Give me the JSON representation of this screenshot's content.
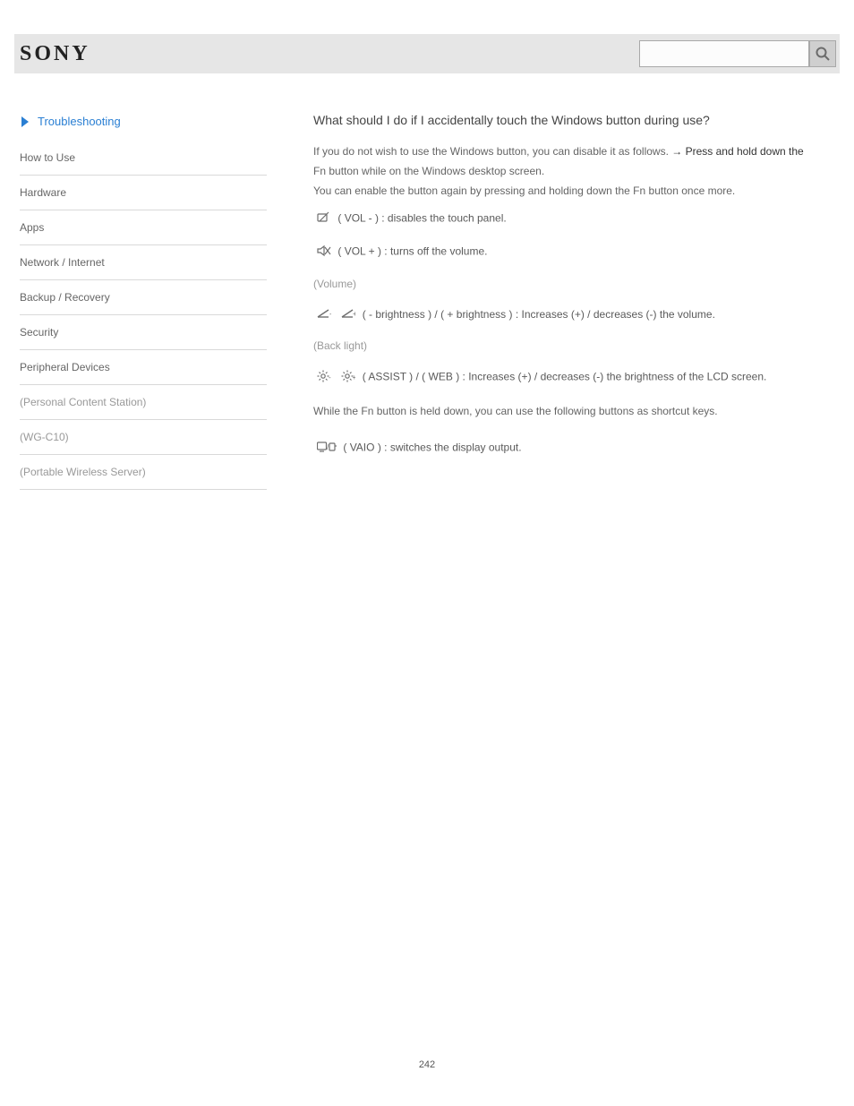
{
  "header": {
    "logo": "SONY",
    "search_placeholder": "",
    "search_value": ""
  },
  "sidebar": {
    "back_link": "Troubleshooting",
    "items": [
      "How to Use",
      "Hardware",
      "Apps",
      "Network / Internet",
      "Backup / Recovery",
      "Security",
      "Peripheral Devices",
      "(Personal Content Station)",
      "(WG-C10)",
      "(Portable Wireless Server)"
    ]
  },
  "content": {
    "title": "What should I do if I accidentally touch the Windows button during use?",
    "intro_pre": "If you do not wish to use the ",
    "intro_btn": "Windows",
    "intro_mid": " button, you can disable it as follows. ",
    "intro_hint": "→ Press and hold down the",
    "hold_label": "Fn",
    "hold_post": " button while on the Windows desktop screen.",
    "reenable": "You can enable the button again by pressing and holding down the ",
    "reenable_btn": "Fn",
    "reenable_post": " button once more.",
    "note": "While the ",
    "note_btn": "Fn",
    "note_end": " button is held down, you can use the following buttons as shortcut keys.",
    "rows": {
      "touchpad": {
        "icon": "touchpad-off-icon",
        "before": "(",
        "btn": "VOL -",
        "after": ")  :  disables the touch panel."
      },
      "mute": {
        "icon": "mute-icon",
        "before": "(",
        "btn": "VOL +",
        "after": ")  :  turns off the volume."
      },
      "volume_label": "(Volume)",
      "volume": {
        "icon_minus": "volume-down-icon",
        "icon_plus": "volume-up-icon",
        "before_a": "(",
        "btn_a": "- brightness",
        "mid": " ) / ",
        "before_b": "(",
        "btn_b": "+ brightness",
        "after": " )  :  Increases (+) / decreases (-) the volume."
      },
      "brightness_label": "(Back light)",
      "brightness": {
        "icon_minus": "brightness-down-icon",
        "icon_plus": "brightness-up-icon",
        "before_a": "(",
        "btn_a": "ASSIST",
        "mid": " ) / ",
        "before_b": "(",
        "btn_b": "WEB",
        "after": " )  :  Increases (+) / decreases (-) the brightness of the LCD screen."
      },
      "display": {
        "icon": "display-output-icon",
        "before": "(",
        "btn": "VAIO",
        "after": ")  :  switches the display output."
      }
    }
  },
  "page_number": "242"
}
